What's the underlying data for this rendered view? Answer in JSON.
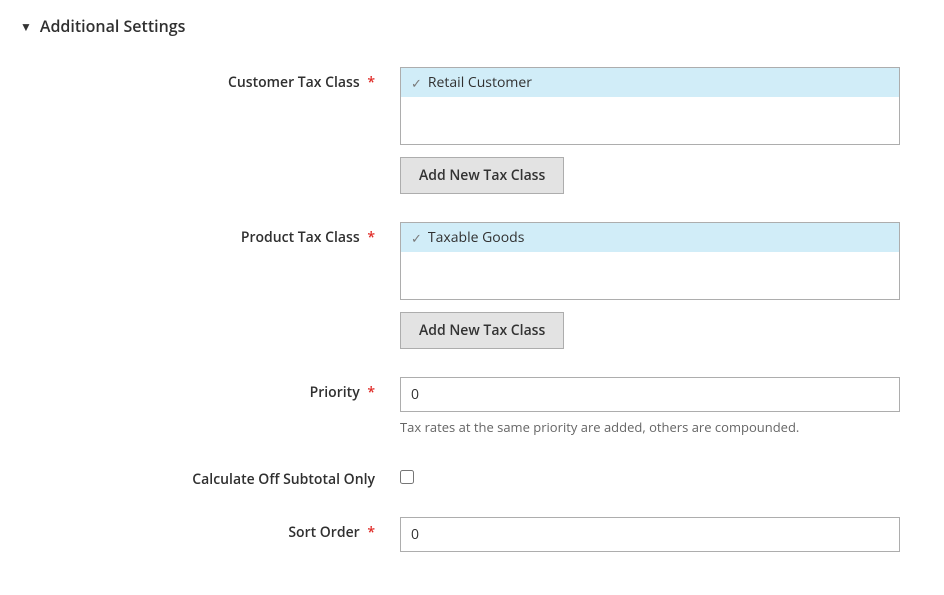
{
  "section": {
    "title": "Additional Settings"
  },
  "fields": {
    "customer_tax_class": {
      "label": "Customer Tax Class",
      "options": [
        {
          "label": "Retail Customer",
          "selected": true
        }
      ],
      "add_button": "Add New Tax Class"
    },
    "product_tax_class": {
      "label": "Product Tax Class",
      "options": [
        {
          "label": "Taxable Goods",
          "selected": true
        }
      ],
      "add_button": "Add New Tax Class"
    },
    "priority": {
      "label": "Priority",
      "value": "0",
      "help": "Tax rates at the same priority are added, others are compounded."
    },
    "calculate_off_subtotal": {
      "label": "Calculate Off Subtotal Only",
      "checked": false
    },
    "sort_order": {
      "label": "Sort Order",
      "value": "0"
    }
  }
}
